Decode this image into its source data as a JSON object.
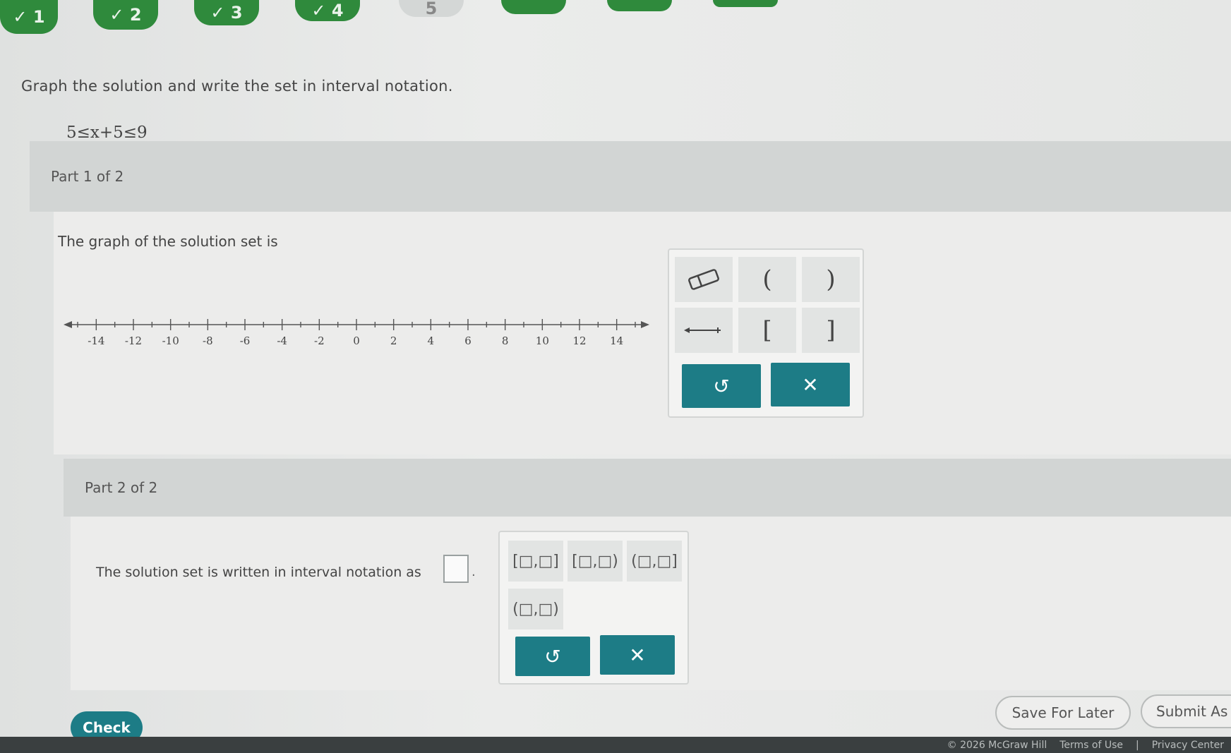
{
  "nav": {
    "tabs": [
      {
        "label": "✓ 1"
      },
      {
        "label": "✓ 2"
      },
      {
        "label": "✓ 3"
      },
      {
        "label": "✓ 4"
      },
      {
        "label": "5"
      },
      {
        "label": ""
      },
      {
        "label": ""
      },
      {
        "label": ""
      }
    ]
  },
  "question": {
    "prompt": "Graph the solution and write the set in interval notation.",
    "inequality": "5≤x+5≤9"
  },
  "part1": {
    "header": "Part 1 of 2",
    "caption": "The graph of the solution set is",
    "numberline": {
      "min": -15,
      "max": 15,
      "labels": [
        "-14",
        "-12",
        "-10",
        "-8",
        "-6",
        "-4",
        "-2",
        "0",
        "2",
        "4",
        "6",
        "8",
        "10",
        "12",
        "14"
      ]
    },
    "tools": {
      "open_left": "(",
      "open_right": ")",
      "closed_left": "[",
      "closed_right": "]"
    },
    "undo": "↺",
    "clear": "✕"
  },
  "part2": {
    "header": "Part 2 of 2",
    "prompt": "The solution set is written in interval notation as",
    "period": ".",
    "templates": [
      "[□,□]",
      "[□,□)",
      "(□,□]",
      "(□,□)"
    ],
    "undo": "↺",
    "clear": "✕"
  },
  "footer_actions": {
    "check": "Check",
    "save": "Save For Later",
    "submit": "Submit As"
  },
  "footer": {
    "copyright": "© 2026 McGraw Hill",
    "terms": "Terms of Use",
    "separator": "|",
    "privacy": "Privacy Center"
  }
}
